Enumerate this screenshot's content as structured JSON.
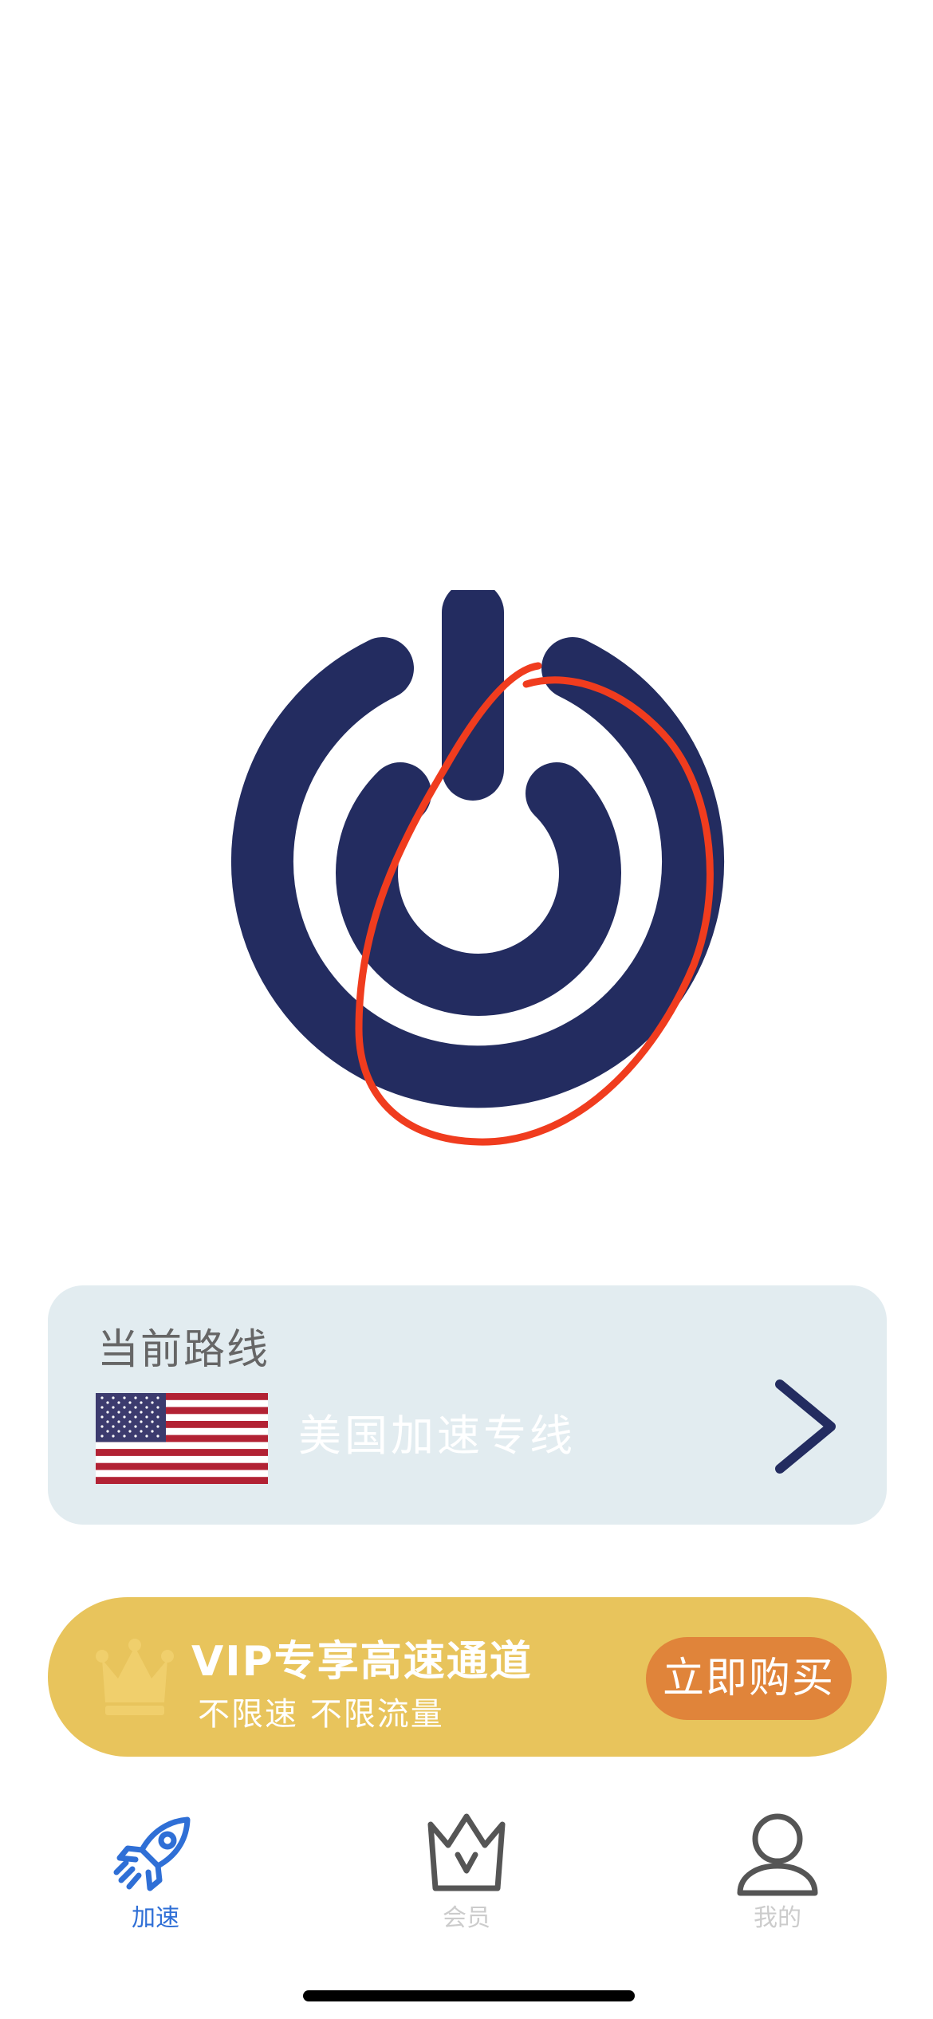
{
  "power": {
    "icon": "power-icon",
    "color": "#232c60"
  },
  "annotation": {
    "color": "#f03c1e"
  },
  "route": {
    "title": "当前路线",
    "flag_icon": "us-flag-icon",
    "name": "美国加速专线",
    "chevron_icon": "chevron-right-icon"
  },
  "vip_banner": {
    "crown_icon": "crown-icon",
    "title": "VIP专享高速通道",
    "subtitle": "不限速 不限流量",
    "buy_label": "立即购买",
    "background": "#e8c45c",
    "button_color": "#e0843a"
  },
  "tabbar": {
    "tabs": [
      {
        "label": "加速",
        "icon": "rocket-icon",
        "active": true,
        "color": "#2f6fd6"
      },
      {
        "label": "会员",
        "icon": "crown-outline-icon",
        "active": false,
        "color": "#cccccc"
      },
      {
        "label": "我的",
        "icon": "person-icon",
        "active": false,
        "color": "#cccccc"
      }
    ]
  }
}
